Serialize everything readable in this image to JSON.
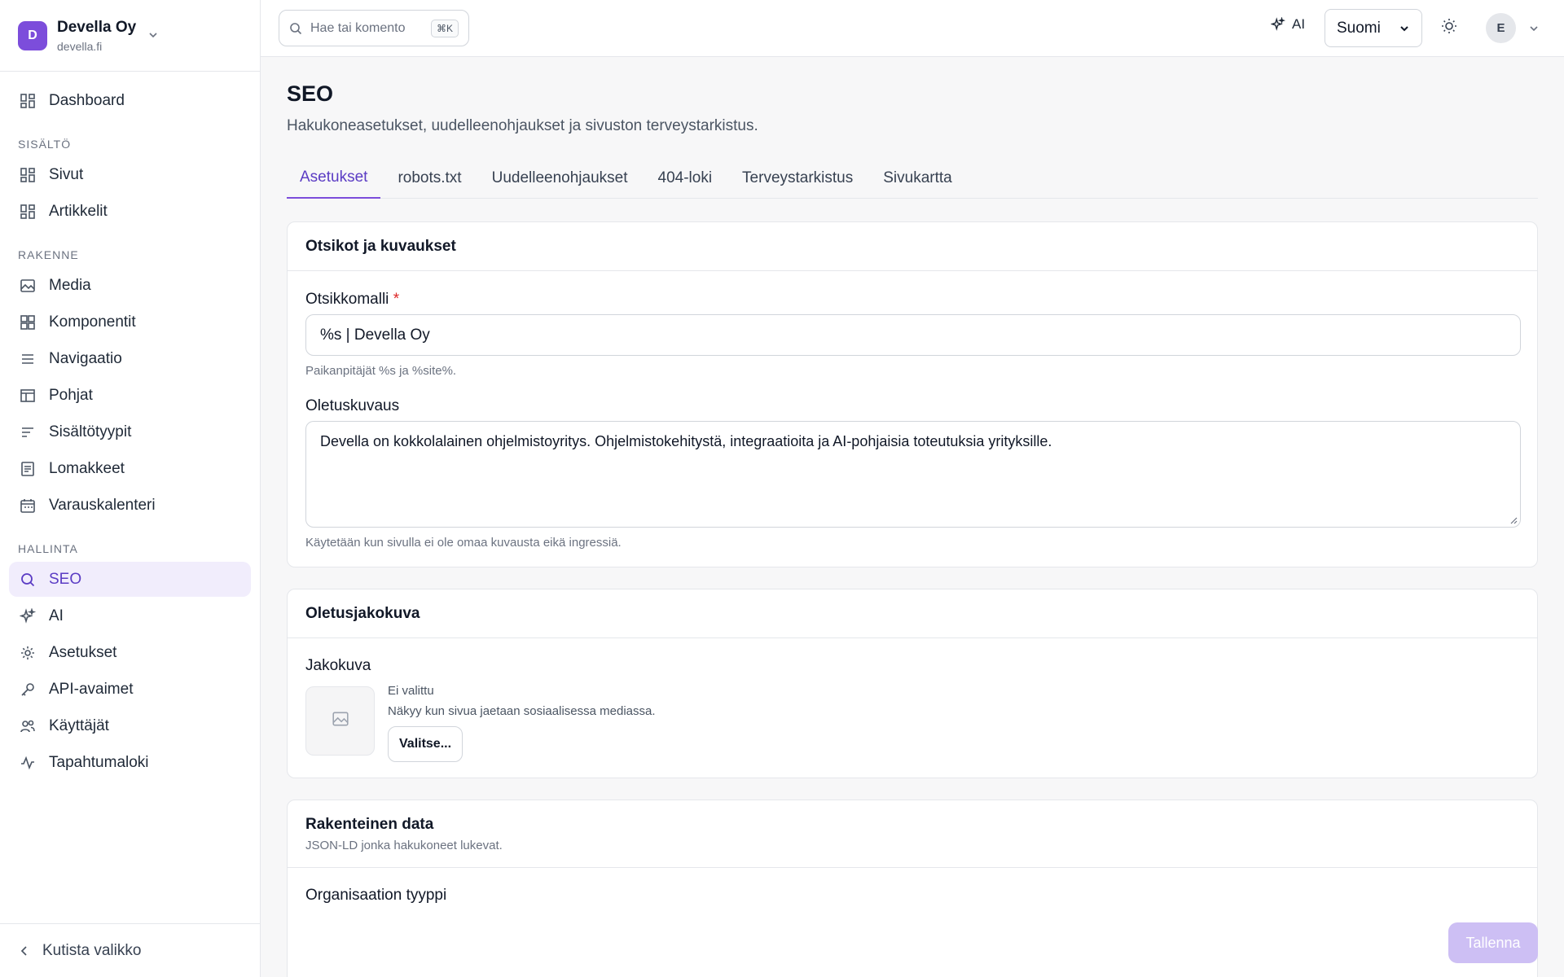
{
  "org": {
    "initial": "D",
    "name": "Devella Oy",
    "domain": "devella.fi"
  },
  "nav": {
    "dashboard": "Dashboard",
    "groups": [
      {
        "label": "SISÄLTÖ",
        "items": [
          "Sivut",
          "Artikkelit"
        ]
      },
      {
        "label": "RAKENNE",
        "items": [
          "Media",
          "Komponentit",
          "Navigaatio",
          "Pohjat",
          "Sisältötyypit",
          "Lomakkeet",
          "Varauskalenteri"
        ]
      },
      {
        "label": "HALLINTA",
        "items": [
          "SEO",
          "AI",
          "Asetukset",
          "API-avaimet",
          "Käyttäjät",
          "Tapahtumaloki"
        ]
      }
    ],
    "active": "SEO",
    "collapse": "Kutista valikko"
  },
  "topbar": {
    "search_placeholder": "Hae tai komento",
    "search_shortcut": "⌘K",
    "ai_label": "AI",
    "language": "Suomi",
    "user_initial": "E"
  },
  "page": {
    "title": "SEO",
    "subtitle": "Hakukoneasetukset, uudelleenohjaukset ja sivuston terveystarkistus.",
    "tabs": [
      "Asetukset",
      "robots.txt",
      "Uudelleenohjaukset",
      "404-loki",
      "Terveystarkistus",
      "Sivukartta"
    ],
    "active_tab": "Asetukset"
  },
  "titles_card": {
    "title": "Otsikot ja kuvaukset",
    "title_template_label": "Otsikkomalli",
    "required_mark": "*",
    "title_template_value": "%s | Devella Oy",
    "title_template_hint": "Paikanpitäjät %s ja %site%.",
    "default_desc_label": "Oletuskuvaus",
    "default_desc_value": "Devella on kokkolalainen ohjelmistoyritys. Ohjelmistokehitystä, integraatioita ja AI-pohjaisia toteutuksia yrityksille.",
    "default_desc_hint": "Käytetään kun sivulla ei ole omaa kuvausta eikä ingressiä."
  },
  "share_card": {
    "title": "Oletusjakokuva",
    "field_label": "Jakokuva",
    "status": "Ei valittu",
    "help": "Näkyy kun sivua jaetaan sosiaalisessa mediassa.",
    "choose_button": "Valitse..."
  },
  "structured_card": {
    "title": "Rakenteinen data",
    "desc": "JSON-LD jonka hakukoneet lukevat.",
    "org_type_label": "Organisaation tyyppi"
  },
  "save_button": "Tallenna",
  "colors": {
    "accent": "#7c4ddb",
    "accent_active_bg": "#f1edfc",
    "save_disabled": "#cdbff4"
  }
}
